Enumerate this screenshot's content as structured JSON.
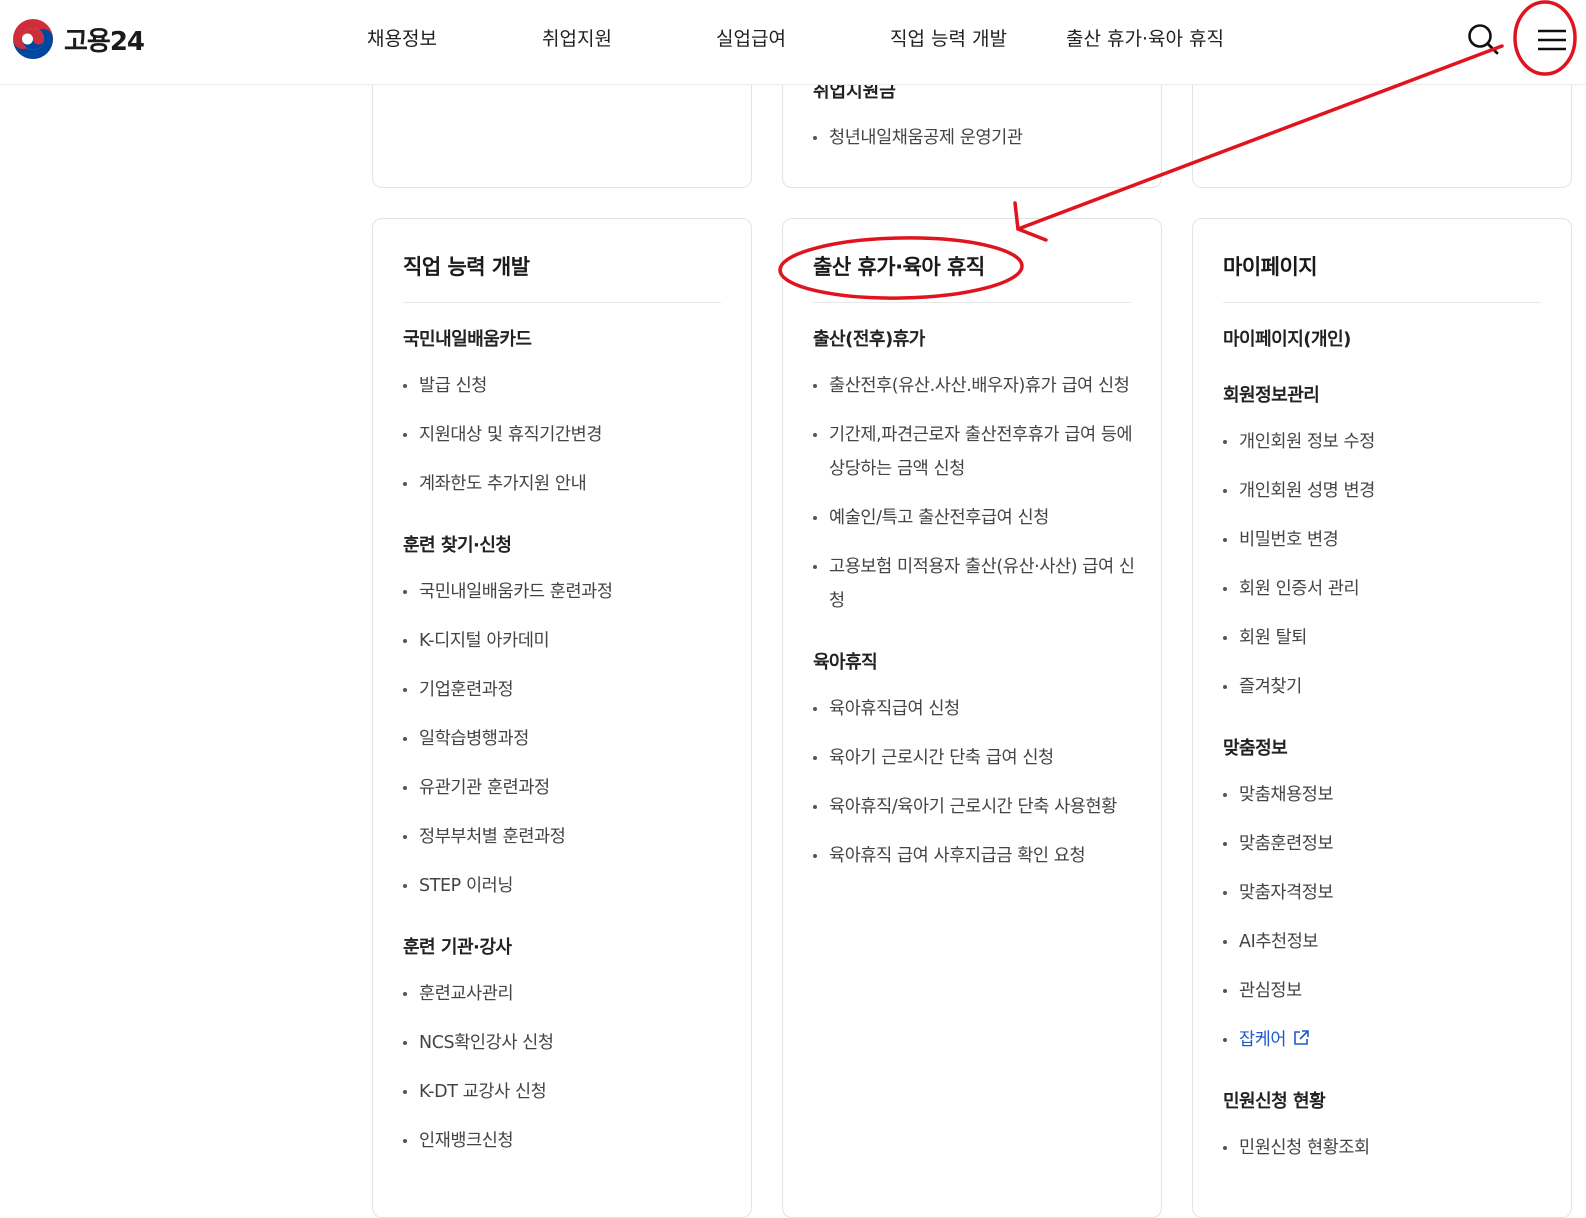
{
  "brand": {
    "name": "고용24"
  },
  "nav": {
    "items": [
      {
        "id": "jobs",
        "label": "채용정보"
      },
      {
        "id": "support",
        "label": "취업지원"
      },
      {
        "id": "unemployment",
        "label": "실업급여"
      },
      {
        "id": "skills",
        "label": "직업 능력 개발"
      },
      {
        "id": "leave",
        "label": "출산 휴가·육아 휴직"
      }
    ]
  },
  "top_cards": {
    "middle": {
      "heading_partial": "취업지원금",
      "item": "청년내일채움공제 운영기관"
    }
  },
  "cards": [
    {
      "title": "직업 능력 개발",
      "groups": [
        {
          "title": "국민내일배움카드",
          "items": [
            "발급 신청",
            "지원대상 및 휴직기간변경",
            "계좌한도 추가지원 안내"
          ]
        },
        {
          "title": "훈련 찾기·신청",
          "items": [
            "국민내일배움카드 훈련과정",
            "K-디지털 아카데미",
            "기업훈련과정",
            "일학습병행과정",
            "유관기관 훈련과정",
            "정부부처별 훈련과정",
            "STEP 이러닝"
          ]
        },
        {
          "title": "훈련 기관·강사",
          "items": [
            "훈련교사관리",
            "NCS확인강사 신청",
            "K-DT 교강사 신청",
            "인재뱅크신청"
          ]
        }
      ]
    },
    {
      "title": "출산 휴가·육아 휴직",
      "groups": [
        {
          "title": "출산(전후)휴가",
          "items": [
            "출산전후(유산.사산.배우자)휴가 급여 신청",
            "기간제,파견근로자 출산전후휴가 급여 등에 상당하는 금액 신청",
            "예술인/특고 출산전후급여 신청",
            "고용보험 미적용자 출산(유산·사산) 급여 신청"
          ]
        },
        {
          "title": "육아휴직",
          "items": [
            "육아휴직급여 신청",
            "육아기 근로시간 단축 급여 신청",
            "육아휴직/육아기 근로시간 단축 사용현황",
            "육아휴직 급여 사후지급금 확인 요청"
          ]
        }
      ]
    },
    {
      "title": "마이페이지",
      "groups": [
        {
          "title": "마이페이지(개인)",
          "items": []
        },
        {
          "title": "회원정보관리",
          "items": [
            "개인회원 정보 수정",
            "개인회원 성명 변경",
            "비밀번호 변경",
            "회원 인증서 관리",
            "회원 탈퇴",
            "즐겨찾기"
          ]
        },
        {
          "title": "맞춤정보",
          "items": [
            "맞춤채용정보",
            "맞춤훈련정보",
            "맞춤자격정보",
            "AI추천정보",
            "관심정보",
            "잡케어"
          ]
        },
        {
          "title": "민원신청 현황",
          "items": [
            "민원신청 현황조회"
          ]
        }
      ]
    }
  ],
  "links": {
    "external_item": "잡케어"
  },
  "colors": {
    "annotation": "#e0141e",
    "link": "#2259c9",
    "brand_red": "#cd2e3a",
    "brand_blue": "#0047a0"
  },
  "icons": {
    "search": "search-icon",
    "menu": "hamburger-menu-icon",
    "external": "external-link-icon"
  }
}
